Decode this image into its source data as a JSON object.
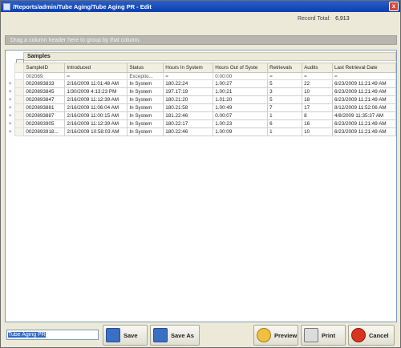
{
  "window": {
    "title": "/Reports/admin/Tube Aging/Tube Aging PR - Edit",
    "close_label": "x"
  },
  "record": {
    "label": "Record Total:",
    "value": "6,913"
  },
  "grid": {
    "group_hint": "Drag a column header here to group by that column.",
    "band_label": "Samples",
    "columns": [
      "SampleID",
      "Introduced",
      "Status",
      "Hours In System",
      "Hours Out of Syste",
      "Retrievals",
      "Audits",
      "Last Retrieval Date"
    ],
    "filters": [
      "002089",
      "=",
      "Exceptio...",
      "=",
      "0:00:00",
      "=",
      "=",
      "="
    ],
    "rows": [
      [
        "0020893833",
        "2/16/2009 11:01:48 AM",
        "In System",
        "180.22:24",
        "1.00:27",
        "5",
        "22",
        "6/23/2009 11:21:49 AM"
      ],
      [
        "0020893845",
        "1/30/2009 4:13:23 PM",
        "In System",
        "197.17:19",
        "1.00:21",
        "3",
        "10",
        "6/23/2009 11:21:49 AM"
      ],
      [
        "0020893847",
        "2/16/2009 11:12:39 AM",
        "In System",
        "180.21:20",
        "1.01:20",
        "5",
        "18",
        "6/23/2009 11:21:49 AM"
      ],
      [
        "0020893881",
        "2/16/2009 11:06:04 AM",
        "In System",
        "180.21:58",
        "1.00:49",
        "7",
        "17",
        "8/12/2009 11:52:06 AM"
      ],
      [
        "0020893887",
        "2/16/2009 11:00:15 AM",
        "In System",
        "181.22:46",
        "0.00:07",
        "1",
        "8",
        "4/8/2009 11:35:37 AM"
      ],
      [
        "0020893905",
        "2/16/2009 11:12:39 AM",
        "In System",
        "180.22:17",
        "1.00:23",
        "6",
        "16",
        "6/23/2009 11:21:49 AM"
      ],
      [
        "0020893918...",
        "2/16/2009 10:58:03 AM",
        "In System",
        "180.22:46",
        "1.00:09",
        "1",
        "10",
        "6/23/2009 11:21:49 AM"
      ]
    ]
  },
  "bottom": {
    "filename": "Tube Aging PR",
    "save": "Save",
    "save_as": "Save As",
    "preview": "Preview",
    "print": "Print",
    "cancel": "Cancel"
  }
}
